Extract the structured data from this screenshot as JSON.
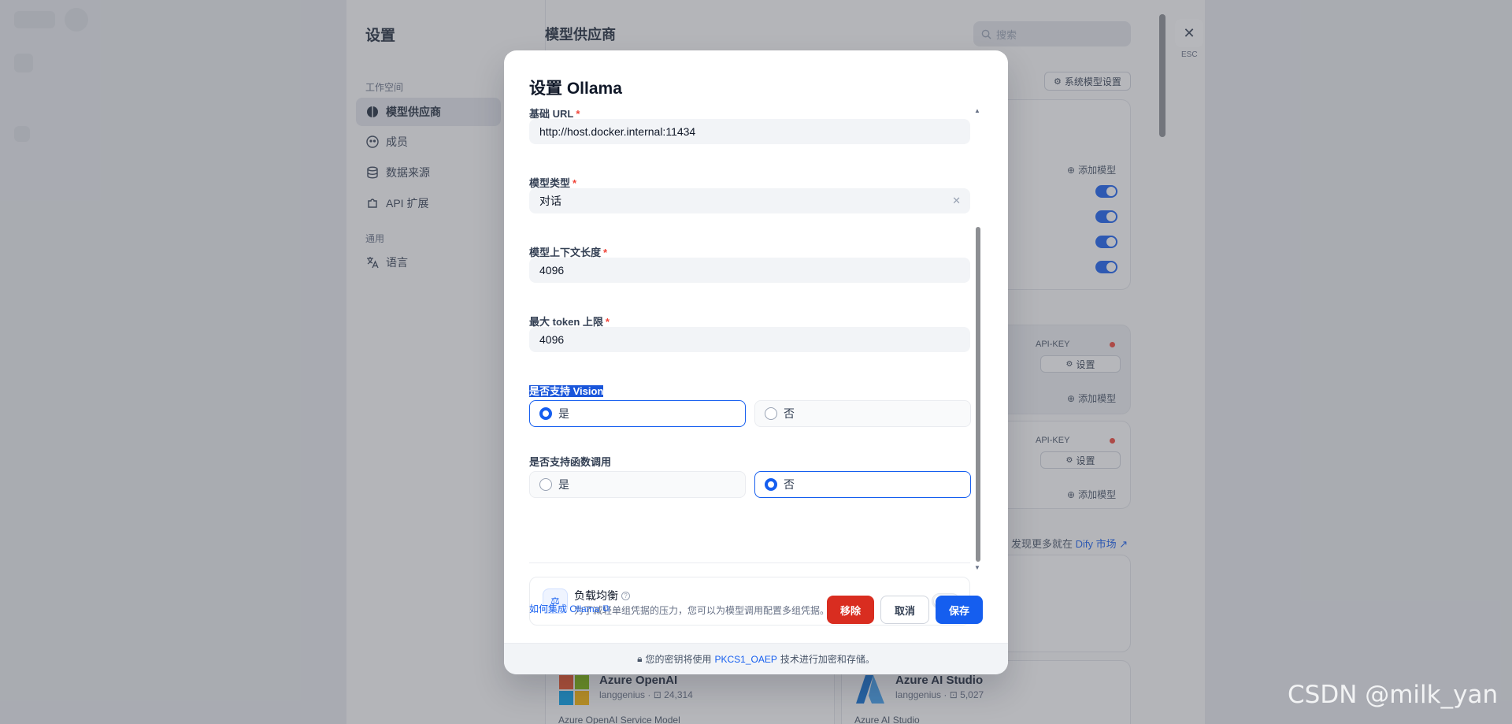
{
  "settings": {
    "title": "设置",
    "workspace_group": "工作空间",
    "general_group": "通用",
    "nav": [
      {
        "label": "模型供应商",
        "icon": "brain-icon",
        "active": true
      },
      {
        "label": "成员",
        "icon": "members-icon"
      },
      {
        "label": "数据来源",
        "icon": "database-icon"
      },
      {
        "label": "API 扩展",
        "icon": "puzzle-icon"
      },
      {
        "label": "语言",
        "icon": "translate-icon"
      }
    ]
  },
  "content": {
    "title": "模型供应商",
    "search_placeholder": "搜索",
    "system_model_button": "系统模型设置",
    "add_model_label": "添加模型",
    "api_key_label": "API-KEY",
    "setup_label": "设置",
    "discover_text": "发现更多就在",
    "discover_link": "Dify 市场",
    "plugins": [
      {
        "name": "Azure OpenAI",
        "author": "langgenius",
        "downloads": "24,314",
        "description": "Azure OpenAI Service Model"
      },
      {
        "name": "Azure AI Studio",
        "author": "langgenius",
        "downloads": "5,027",
        "description": "Azure AI Studio"
      }
    ]
  },
  "close": {
    "label": "ESC"
  },
  "modal": {
    "title": "设置 Ollama",
    "fields": {
      "base_url": {
        "label": "基础 URL",
        "value": "http://host.docker.internal:11434"
      },
      "model_type": {
        "label": "模型类型",
        "value": "对话"
      },
      "context_length": {
        "label": "模型上下文长度",
        "value": "4096"
      },
      "max_tokens": {
        "label": "最大 token 上限",
        "value": "4096"
      },
      "vision": {
        "label": "是否支持 Vision",
        "yes": "是",
        "no": "否",
        "selected": "是"
      },
      "function_call": {
        "label": "是否支持函数调用",
        "yes": "是",
        "no": "否",
        "selected": "否"
      }
    },
    "load_balancing": {
      "title": "负载均衡",
      "description": "为了减轻单组凭据的压力，您可以为模型调用配置多组凭据。",
      "enabled": false
    },
    "help_link": "如何集成 Ollama",
    "buttons": {
      "remove": "移除",
      "cancel": "取消",
      "save": "保存"
    },
    "footer": {
      "before": "您的密钥将使用",
      "link": "PKCS1_OAEP",
      "after": "技术进行加密和存储。"
    }
  },
  "watermark": "CSDN @milk_yan",
  "colors": {
    "primary": "#155eef",
    "danger": "#d92d20",
    "required": "#f04438"
  }
}
